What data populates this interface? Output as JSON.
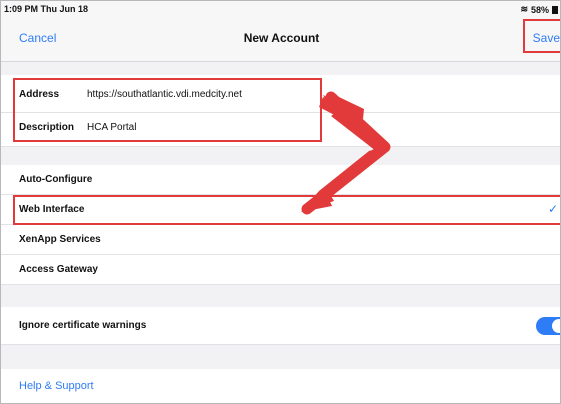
{
  "status": {
    "time": "1:09 PM  Thu Jun 18",
    "battery": "58%"
  },
  "nav": {
    "cancel": "Cancel",
    "title": "New Account",
    "save": "Save"
  },
  "fields": [
    {
      "label": "Address",
      "value": "https://southatlantic.vdi.medcity.net"
    },
    {
      "label": "Description",
      "value": "HCA Portal"
    }
  ],
  "config_items": [
    {
      "label": "Auto-Configure"
    },
    {
      "label": "Web Interface",
      "selected": true
    },
    {
      "label": "XenApp Services"
    },
    {
      "label": "Access Gateway"
    }
  ],
  "ignore_cert": {
    "label": "Ignore certificate warnings",
    "enabled": true
  },
  "help": "Help & Support",
  "colors": {
    "accent": "#2e7cf6",
    "annotation": "#e23a3a"
  }
}
